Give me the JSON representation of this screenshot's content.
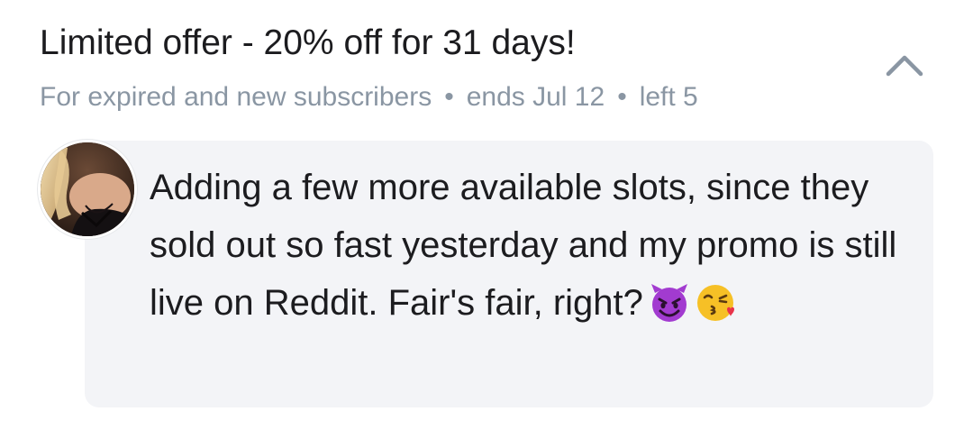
{
  "offer": {
    "title": "Limited offer - 20% off for 31 days!",
    "audience": "For expired and new subscribers",
    "separator": "•",
    "ends": "ends Jul 12",
    "remaining": "left 5"
  },
  "controls": {
    "collapse_icon": "chevron-up-icon"
  },
  "message": {
    "text": "Adding a few more available slots, since they sold out so fast yesterday and my promo is still live on Reddit. Fair's fair, right?",
    "emojis": [
      "smiling-devil-emoji",
      "kissing-face-emoji"
    ]
  },
  "colors": {
    "title": "#1c1c1f",
    "meta": "#8a96a3",
    "bubble": "#f3f4f7",
    "chevron": "#8a96a3"
  }
}
